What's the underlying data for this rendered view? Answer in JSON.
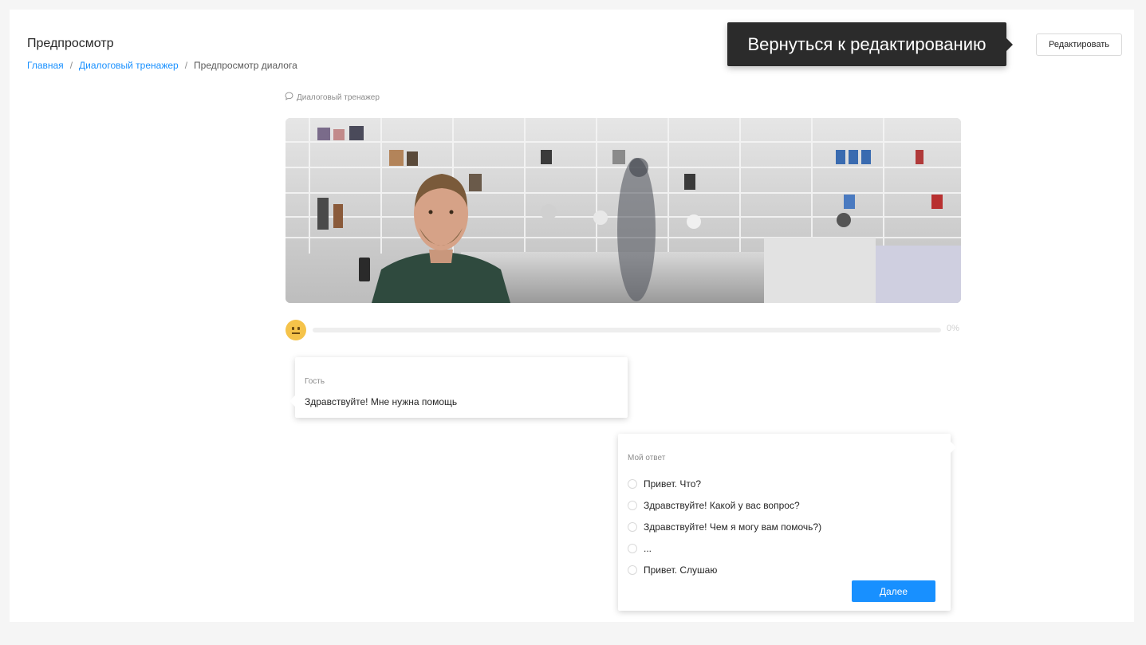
{
  "header": {
    "title": "Предпросмотр",
    "breadcrumb": [
      {
        "label": "Главная"
      },
      {
        "label": "Диалоговый тренажер"
      },
      {
        "label": "Предпросмотр диалога"
      }
    ],
    "edit_button": "Редактировать",
    "tooltip": "Вернуться к редактированию"
  },
  "trainer": {
    "label": "Диалоговый тренажер",
    "icon": "chat-bubble-icon"
  },
  "progress": {
    "mood_icon": "neutral-face-icon",
    "value": 0,
    "label": "0%"
  },
  "guest": {
    "label": "Гость",
    "message": "Здравствуйте! Мне нужна помощь"
  },
  "answer": {
    "label": "Мой ответ",
    "options": [
      "Привет. Что?",
      "Здравствуйте! Какой у вас вопрос?",
      "Здравствуйте! Чем я могу вам помочь?)",
      "...",
      "Привет. Слушаю"
    ],
    "next_button": "Далее"
  },
  "colors": {
    "link": "#1890ff",
    "primary": "#1890ff",
    "tooltip_bg": "#2b2b2b",
    "emoji": "#f5c34a"
  }
}
